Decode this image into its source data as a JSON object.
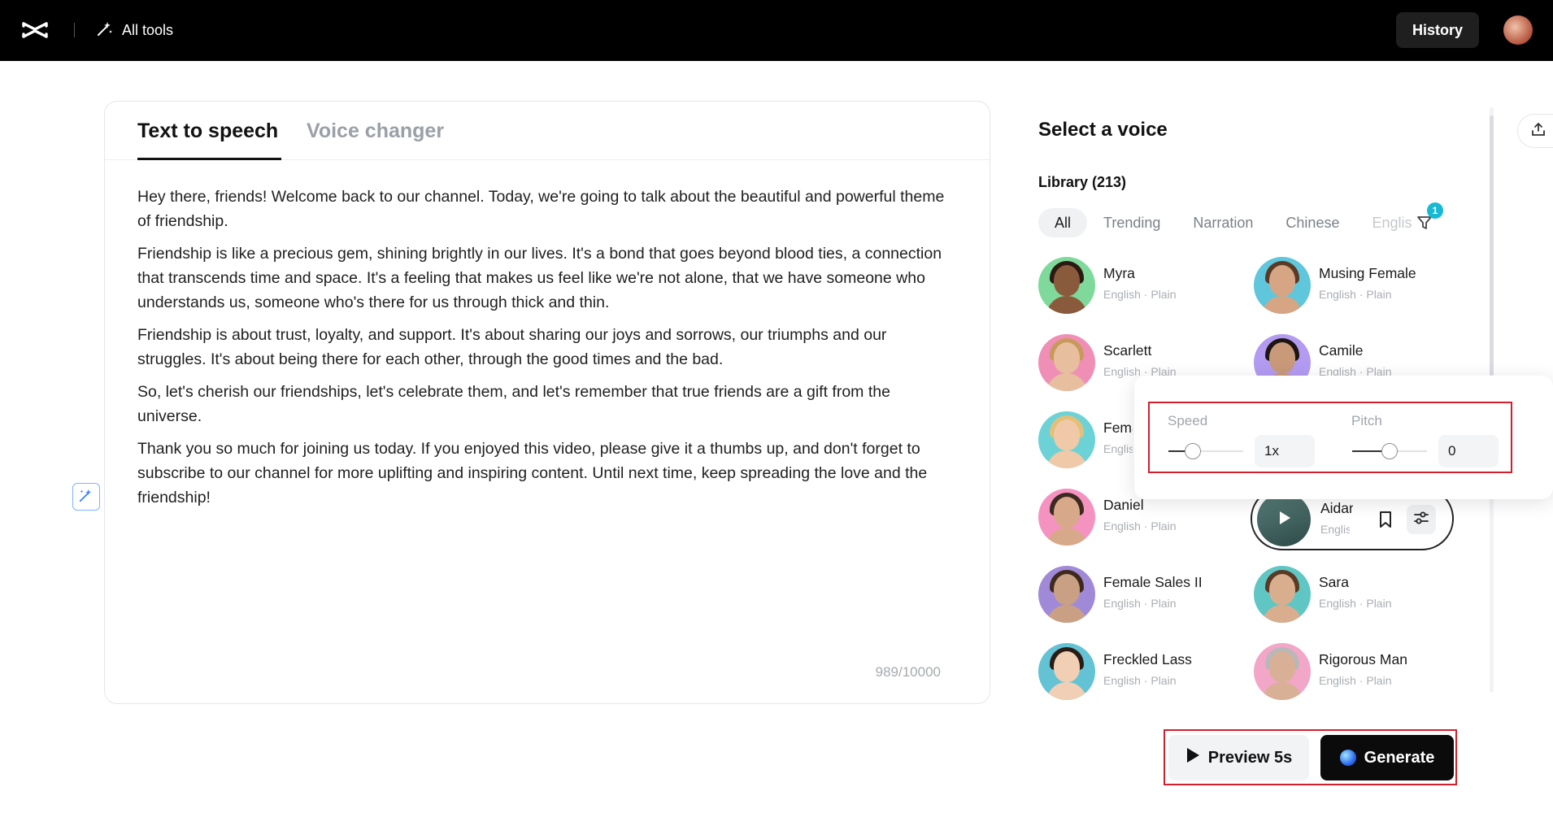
{
  "topbar": {
    "all_tools_label": "All tools",
    "history_label": "History"
  },
  "editor": {
    "tabs": [
      {
        "label": "Text to speech",
        "active": true
      },
      {
        "label": "Voice changer",
        "active": false
      }
    ],
    "paragraphs": [
      "Hey there, friends! Welcome back to our channel. Today, we're going to talk about the beautiful and powerful theme of friendship.",
      "Friendship is like a precious gem, shining brightly in our lives. It's a bond that goes beyond blood ties, a connection that transcends time and space. It's a feeling that makes us feel like we're not alone, that we have someone who understands us, someone who's there for us through thick and thin.",
      "Friendship is about trust, loyalty, and support. It's about sharing our joys and sorrows, our triumphs and our struggles. It's about being there for each other, through the good times and the bad.",
      "So, let's cherish our friendships, let's celebrate them, and let's remember that true friends are a gift from the universe.",
      "Thank you so much for joining us today. If you enjoyed this video, please give it a thumbs up, and don't forget to subscribe to our channel for more uplifting and inspiring content. Until next time, keep spreading the love and the friendship!"
    ],
    "char_count": "989/10000"
  },
  "voice_panel": {
    "title": "Select a voice",
    "library_label": "Library (213)",
    "filters": [
      "All",
      "Trending",
      "Narration",
      "Chinese",
      "Englis"
    ],
    "filter_badge": "1",
    "voices": [
      {
        "name": "Myra",
        "sub": "English · Plain",
        "bg": "#7fd99a",
        "skin": "#8a5a3c",
        "hair": "#2a1a12"
      },
      {
        "name": "Musing Female",
        "sub": "English · Plain",
        "bg": "#5fc6dc",
        "skin": "#d6a583",
        "hair": "#5a3a24"
      },
      {
        "name": "Scarlett",
        "sub": "English · Plain",
        "bg": "#f08fb6",
        "skin": "#e7bf9f",
        "hair": "#c79a5c"
      },
      {
        "name": "Camile",
        "sub": "English · Plain",
        "bg": "#b39bf2",
        "skin": "#c89a7a",
        "hair": "#1e1410"
      },
      {
        "name": "Female",
        "sub": "English · Plain",
        "bg": "#6dd2d6",
        "skin": "#f0c9a8",
        "hair": "#e3c07a"
      },
      {
        "name": "Daniel",
        "sub": "English · Plain",
        "bg": "#f593c0",
        "skin": "#d8a88a",
        "hair": "#3a2a20"
      },
      {
        "name": "Female Sales II",
        "sub": "English · Plain",
        "bg": "#a08ad8",
        "skin": "#caa084",
        "hair": "#3e2a1c"
      },
      {
        "name": "Sara",
        "sub": "English · Plain",
        "bg": "#5fc6c4",
        "skin": "#d9ae8e",
        "hair": "#5a3a24"
      },
      {
        "name": "Freckled Lass",
        "sub": "English · Plain",
        "bg": "#63c2d4",
        "skin": "#f0cfb4",
        "hair": "#2a1c14"
      },
      {
        "name": "Rigorous Man",
        "sub": "English · Plain",
        "bg": "#f2a6c8",
        "skin": "#d8b096",
        "hair": "#b8b8b8"
      }
    ],
    "selected_voice": {
      "name": "Aidan",
      "sub": "English · Plain"
    }
  },
  "settings_popover": {
    "speed_label": "Speed",
    "speed_value": "1x",
    "speed_level": 0.33,
    "pitch_label": "Pitch",
    "pitch_value": "0",
    "pitch_level": 0.5
  },
  "actions": {
    "preview_label": "Preview 5s",
    "generate_label": "Generate"
  }
}
